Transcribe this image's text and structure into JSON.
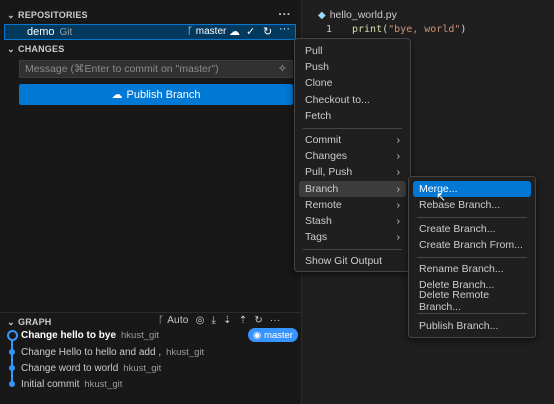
{
  "sections": {
    "repositories": "REPOSITORIES",
    "changes": "CHANGES",
    "graph": "GRAPH"
  },
  "repo": {
    "name": "demo",
    "type": "Git",
    "branch": "master"
  },
  "commit_input": {
    "placeholder": "Message (⌘Enter to commit on \"master\")"
  },
  "publish_button": "Publish Branch",
  "graph_tools": {
    "auto_label": "Auto"
  },
  "graph": {
    "badge": "master",
    "commits": [
      {
        "message": "Change hello to bye",
        "author": "hkust_git"
      },
      {
        "message": "Change Hello to hello and add ,",
        "author": "hkust_git"
      },
      {
        "message": "Change word to world",
        "author": "hkust_git"
      },
      {
        "message": "Initial commit",
        "author": "hkust_git"
      }
    ]
  },
  "editor": {
    "tab": "hello_world.py",
    "line_number": "1",
    "code_fn": "print",
    "code_open": "(",
    "code_str": "\"bye, world\"",
    "code_close": ")"
  },
  "more_menu": {
    "items": [
      "Pull",
      "Push",
      "Clone",
      "Checkout to...",
      "Fetch",
      "Commit",
      "Changes",
      "Pull, Push",
      "Branch",
      "Remote",
      "Stash",
      "Tags",
      "Show Git Output"
    ]
  },
  "branch_menu": {
    "items": [
      "Merge...",
      "Rebase Branch...",
      "Create Branch...",
      "Create Branch From...",
      "Rename Branch...",
      "Delete Branch...",
      "Delete Remote Branch...",
      "Publish Branch..."
    ]
  },
  "colors": {
    "accent": "#0078d4",
    "graph_blue": "#3794ff",
    "sidebar_bg": "#181818",
    "menu_bg": "#1f1f1f"
  }
}
